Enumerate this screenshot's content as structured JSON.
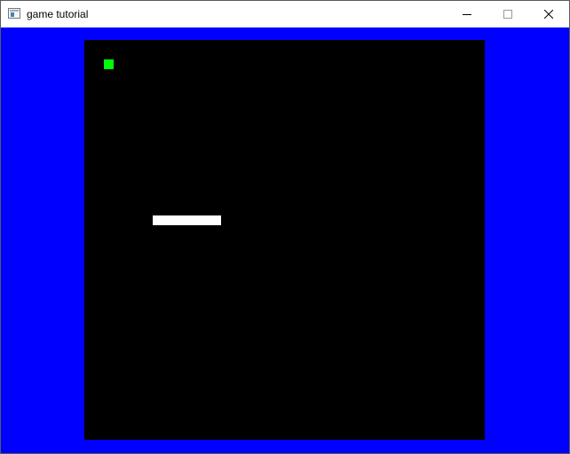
{
  "window": {
    "title": "game tutorial",
    "icon": "application-window-icon",
    "controls": [
      "minimize-icon",
      "maximize-icon",
      "close-icon"
    ]
  },
  "game": {
    "background_color": "#0000ff",
    "playfield_color": "#000000",
    "player": {
      "name": "player-square",
      "color": "#00ff00"
    },
    "platform": {
      "name": "white-platform",
      "color": "#ffffff"
    }
  }
}
